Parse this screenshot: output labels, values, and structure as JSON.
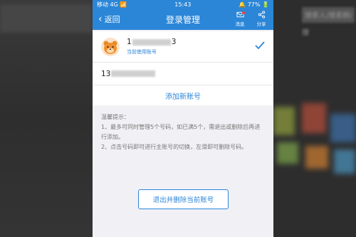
{
  "status_bar": {
    "carrier": "移动 4G 📶",
    "time": "15:43",
    "battery": "🔔 77% 🔋"
  },
  "header": {
    "back_label": "返回",
    "title": "登录管理",
    "message_label": "消息",
    "share_label": "分享"
  },
  "accounts": {
    "current": {
      "number_prefix": "1",
      "number_suffix": "3",
      "subtitle": "当前使用账号"
    },
    "second": {
      "number_prefix": "13"
    },
    "add_label": "添加新账号"
  },
  "tips": {
    "heading": "温馨提示：",
    "line1": "1、最多可同时管理5个号码，如已满5个，需退出或删除后再进行添加。",
    "line2": "2、点击号码即可进行主账号的切换，左滑即可删除号码。"
  },
  "logout_label": "退出并删除当前账号",
  "background": {
    "search_placeholder": "搜索人/搜索群/搜"
  },
  "colors": {
    "accent": "#2b86d8",
    "page_bg": "#f1f1f5",
    "outer_bg": "#2f2f2f"
  }
}
